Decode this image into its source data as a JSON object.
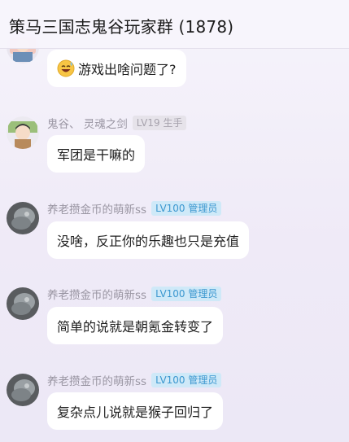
{
  "header": {
    "title": "策马三国志鬼谷玩家群 (1878)"
  },
  "messages": [
    {
      "text": "游戏出啥问题了?",
      "emoji": "grinning-sweat-emoji"
    },
    {
      "nickname": "鬼谷、 灵魂之剑",
      "badge": "LV19 生手",
      "text": "军团是干嘛的"
    },
    {
      "nickname": "养老攒金币的萌新ss",
      "badge": "LV100 管理员",
      "text": "没啥，反正你的乐趣也只是充值"
    },
    {
      "nickname": "养老攒金币的萌新ss",
      "badge": "LV100 管理员",
      "text": "简单的说就是朝氪金转变了"
    },
    {
      "nickname": "养老攒金币的萌新ss",
      "badge": "LV100 管理员",
      "text": "复杂点儿说就是猴子回归了"
    }
  ],
  "colors": {
    "admin_badge_bg": "#cfe9f8",
    "admin_badge_text": "#3b97cf",
    "bubble": "#ffffff"
  }
}
